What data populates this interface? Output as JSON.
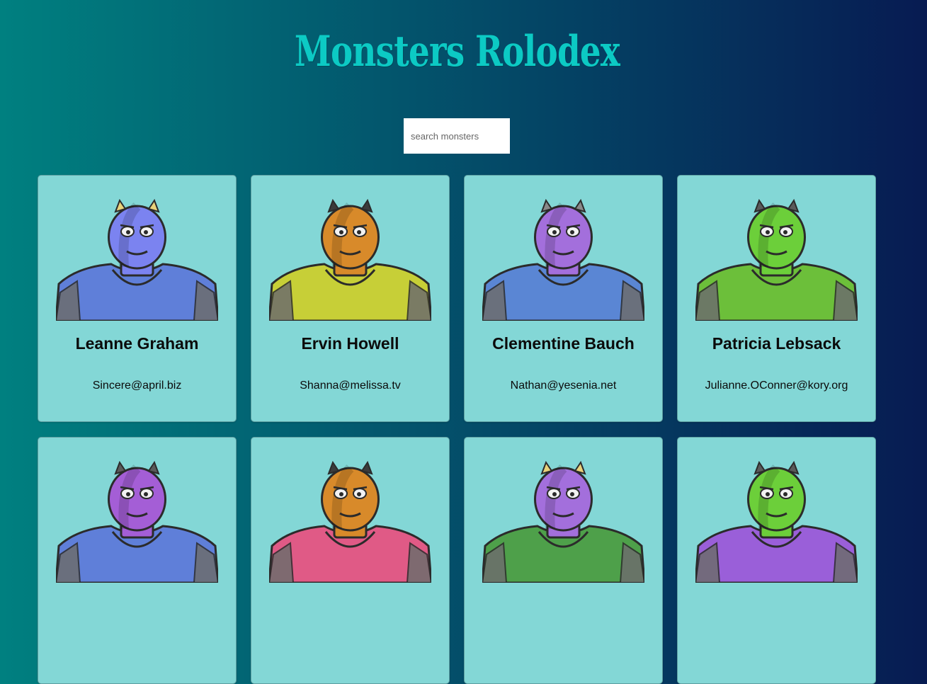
{
  "header": {
    "title": "Monsters Rolodex"
  },
  "search": {
    "placeholder": "search monsters",
    "value": ""
  },
  "monsters": [
    {
      "name": "Leanne Graham",
      "email": "Sincere@april.biz",
      "icon": "horned-blue-monster-icon",
      "skin": "#7b83f0",
      "body": "#5f7fd9",
      "accent": "#e8d27a"
    },
    {
      "name": "Ervin Howell",
      "email": "Shanna@melissa.tv",
      "icon": "orange-spiky-monster-icon",
      "skin": "#d88a2a",
      "body": "#c7cf37",
      "accent": "#3b3b3b"
    },
    {
      "name": "Clementine Bauch",
      "email": "Nathan@yesenia.net",
      "icon": "purple-cyclops-robot-monster-icon",
      "skin": "#a36fdc",
      "body": "#5a86d4",
      "accent": "#8a8a8a"
    },
    {
      "name": "Patricia Lebsack",
      "email": "Julianne.OConner@kory.org",
      "icon": "green-helmet-monster-icon",
      "skin": "#6ccf3a",
      "body": "#6cbf3a",
      "accent": "#5a5a5a"
    },
    {
      "name": "",
      "email": "",
      "icon": "purple-armored-monster-icon",
      "skin": "#a45ed6",
      "body": "#5f7fd9",
      "accent": "#5a5a5a"
    },
    {
      "name": "",
      "email": "",
      "icon": "antenna-orange-monster-icon",
      "skin": "#d88a2a",
      "body": "#e05a86",
      "accent": "#3b3b3b"
    },
    {
      "name": "",
      "email": "",
      "icon": "horned-purple-monster-icon",
      "skin": "#a36fdc",
      "body": "#4ea04a",
      "accent": "#e8d27a"
    },
    {
      "name": "",
      "email": "",
      "icon": "green-robot-monster-icon",
      "skin": "#6ccf3a",
      "body": "#9a5fd9",
      "accent": "#5a5a5a"
    }
  ]
}
